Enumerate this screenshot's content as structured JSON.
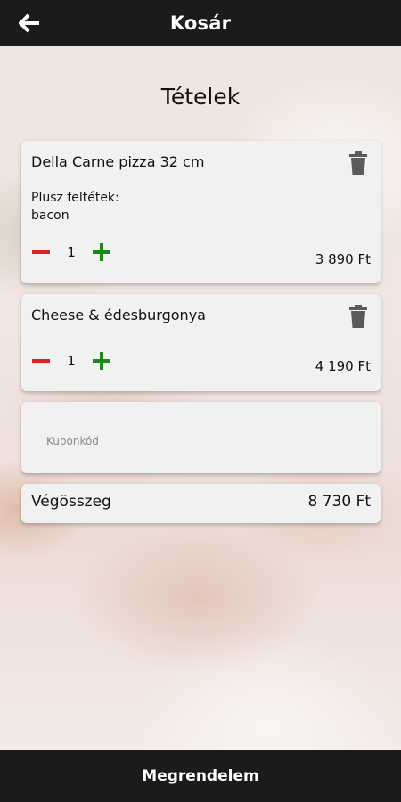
{
  "header": {
    "title": "Kosár",
    "back_icon": "arrow-left-icon"
  },
  "section_title": "Tételek",
  "items": [
    {
      "name": "Della Carne pizza 32 cm",
      "extras_label": "Plusz feltétek:",
      "extras": "bacon",
      "quantity": "1",
      "price": "3 890 Ft"
    },
    {
      "name": "Cheese & édesburgonya",
      "quantity": "1",
      "price": "4 190 Ft"
    }
  ],
  "coupon": {
    "placeholder": "Kuponkód",
    "value": ""
  },
  "total": {
    "label": "Végösszeg",
    "value": "8 730 Ft"
  },
  "footer": {
    "order_label": "Megrendelem"
  },
  "colors": {
    "bar": "#1b1b1b",
    "minus": "#e02020",
    "plus": "#1a8a1a",
    "card": "#f1f1f1"
  }
}
